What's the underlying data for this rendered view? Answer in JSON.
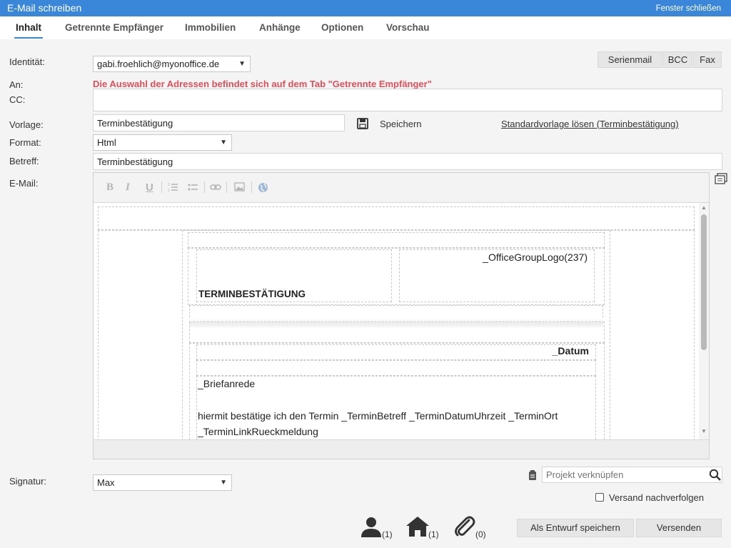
{
  "window": {
    "title": "E-Mail schreiben",
    "close_label": "Fenster schließen"
  },
  "tabs": [
    {
      "label": "Inhalt"
    },
    {
      "label": "Getrennte Empfänger"
    },
    {
      "label": "Immobilien"
    },
    {
      "label": "Anhänge"
    },
    {
      "label": "Optionen"
    },
    {
      "label": "Vorschau"
    }
  ],
  "form": {
    "identity_label": "Identität:",
    "identity_value": "gabi.froehlich@myonoffice.de",
    "to_label": "An:",
    "cc_label": "CC:",
    "address_notice": "Die Auswahl der Adressen befindet sich auf dem Tab \"Getrennte Empfänger\"",
    "cc_value": "",
    "template_label": "Vorlage:",
    "template_value": "Terminbestätigung",
    "save_label": "Speichern",
    "unset_default_label": "Standardvorlage lösen (Terminbestätigung)",
    "format_label": "Format:",
    "format_value": "Html",
    "subject_label": "Betreff:",
    "subject_value": "Terminbestätigung",
    "email_label": "E-Mail:",
    "signature_label": "Signatur:",
    "signature_value": "Max"
  },
  "top_buttons": {
    "serial_mail": "Serienmail",
    "bcc": "BCC",
    "fax": "Fax"
  },
  "toolbar": {
    "bold": "B",
    "italic": "I",
    "underline": "U"
  },
  "editor_doc": {
    "logo_placeholder": "_OfficeGroupLogo(237)",
    "heading": "TERMINBESTÄTIGUNG",
    "date_placeholder": "_Datum",
    "salutation": "_Briefanrede",
    "body_line1": "hiermit bestätige ich den Termin _TerminBetreff _TerminDatumUhrzeit _TerminOrt",
    "body_line2": "_TerminLinkRueckmeldung"
  },
  "project": {
    "placeholder": "Projekt verknüpfen"
  },
  "track": {
    "label": "Versand nachverfolgen",
    "checked": false
  },
  "counters": {
    "contacts": "(1)",
    "properties": "(1)",
    "attachments": "(0)"
  },
  "actions": {
    "save_draft": "Als Entwurf speichern",
    "send": "Versenden"
  },
  "icons": {
    "save": "floppy-disk-icon",
    "notes": "notes-icon",
    "contacts": "person-icon",
    "properties": "house-icon",
    "attachments": "paperclip-icon",
    "search": "search-icon"
  }
}
